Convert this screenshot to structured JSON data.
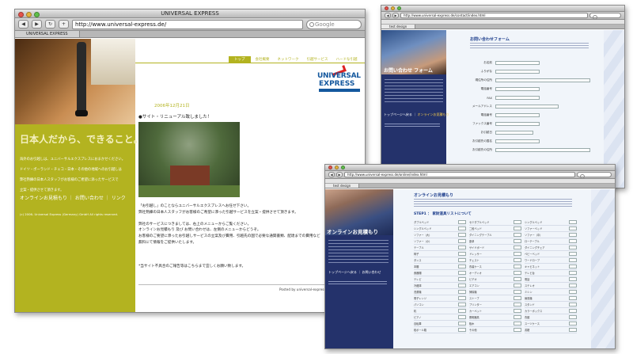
{
  "win1": {
    "window_title": "UNIVERSAL EXPRESS",
    "url": "http://www.universal-express.de/",
    "search_placeholder": "Google",
    "tab": "UNIVERSAL EXPRESS",
    "nav": [
      "トップ",
      "会社概要",
      "ネットワーク",
      "引越サービス",
      "ハードな引越"
    ],
    "logo_line1": "UNIVERSAL",
    "logo_line2": "EXPRESS",
    "tagline": "日本人だから、できること。",
    "intro": [
      "海外のお引越しは、ユニバーサルエクスプレスにおまかせください。",
      "ドイツ・ポーランド・チェコ・日本・その他の地域へのお引越しは",
      "弊社熟練の日本人スタッフがお客様のご希望に添ったサービスで",
      "立案・提供させて頂きます。"
    ],
    "sidebar_links": [
      "オンラインお見積もり",
      "お問い合わせ",
      "リンク"
    ],
    "copyright": "(c) 2006- Universal Express (Germany) GmbH All rights reserved.",
    "date": "2006年12月21日",
    "headline": "●サイト・リニューアル致しました！",
    "body_lines": [
      "「お引越し」のことならユニバーサルエクスプレスへお任せ下さい。",
      "弊社熟練の日本人スタッフがお客様のご希望に添った引越サービスを立案・提供させて頂きます。",
      "",
      "弊社のサービスにつきましては、右上のメニューからご覧ください。",
      "オンラインお見積もり 及び お問い合わせは、左側のメニューからどうぞ。",
      "お客様のご要望に添ったお引越しサービスの立案及び費用、引越先の国で必要な通関書類、配達までの費用など",
      "無料にて情報をご提供いたします。"
    ],
    "note": "*当サイト不具合のご報告等はこちらまで宜しくお願い致します。",
    "posted": "Posted by universal-express"
  },
  "win2": {
    "tab": "test design",
    "url": "http://www.universal-express.de/contact/index.html",
    "banner": "お問い合わせ フォーム",
    "form_title": "お問い合わせフォーム",
    "menu": [
      "トップページへ戻る",
      "オンラインお見積もり"
    ],
    "fields": [
      "お名前",
      "ふりがな",
      "現住所の住所",
      "電話番号",
      "FAX",
      "メールアドレス",
      "電話番号",
      "ファックス番号",
      "お引越日",
      "お引越先の国名",
      "お引越先の住所"
    ]
  },
  "win3": {
    "tab": "test design",
    "url": "http://www.universal-express.de/online/index.html",
    "banner": "オンラインお見積もり",
    "form_title": "オンラインお見積もり",
    "step": "STEP1 ： 家財道具リストについて",
    "menu": [
      "トップページへ戻る",
      "お問い合わせ"
    ],
    "col1": [
      "ダブルベッド",
      "シングルベッド",
      "ソファー（大）",
      "ソファー（小）",
      "テーブル",
      "椅子",
      "タンス",
      "本棚",
      "食器棚",
      "テレビ",
      "冷蔵庫",
      "洗濯機",
      "電子レンジ",
      "パソコン",
      "机",
      "ピアノ",
      "自転車",
      "段ボール箱"
    ],
    "col2": [
      "セミダブルベッド",
      "二段ベッド",
      "ダイニングテーブル",
      "座卓",
      "サイドボード",
      "ドレッサー",
      "チェスト",
      "衣装ケース",
      "オーディオ",
      "ビデオ",
      "エアコン",
      "掃除機",
      "ストーブ",
      "プリンター",
      "カーペット",
      "照明器具",
      "植木",
      "その他"
    ],
    "col3": [
      "シングルベッド",
      "ソファーベッド",
      "ソファー（中）",
      "ローテーブル",
      "ダイニングチェア",
      "ベビーベッド",
      "ワードローブ",
      "キャビネット",
      "テレビ台",
      "電話",
      "ステレオ",
      "ミシン",
      "扇風機",
      "スタンド",
      "カラーボックス",
      "衣類",
      "スーツケース",
      "書籍"
    ]
  }
}
